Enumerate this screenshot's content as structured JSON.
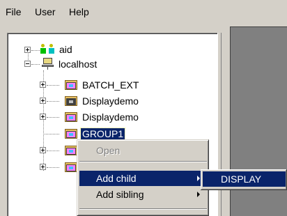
{
  "menubar": {
    "items": [
      "File",
      "User",
      "Help"
    ]
  },
  "tree": {
    "nodes": [
      {
        "label": "aid",
        "icon": "people-icon",
        "expander": "plus"
      },
      {
        "label": "localhost",
        "icon": "computer-icon",
        "expander": "minus"
      },
      {
        "label": "BATCH_EXT",
        "icon": "folder-icon",
        "expander": "plus"
      },
      {
        "label": "Displaydemo",
        "icon": "folder-icon",
        "expander": "plus"
      },
      {
        "label": "Displaydemo",
        "icon": "folder-icon",
        "expander": "plus"
      },
      {
        "label": "GROUP1",
        "icon": "folder-icon",
        "selected": true
      },
      {
        "label": "",
        "icon": "folder-icon",
        "expander": "plus"
      },
      {
        "label": "",
        "icon": "folder-icon",
        "expander": "plus"
      }
    ]
  },
  "context_menu": {
    "items": [
      {
        "label": "Open",
        "state": "disabled"
      },
      {
        "label": "Add child",
        "state": "active",
        "submenu": true
      },
      {
        "label": "Add sibling",
        "state": "normal",
        "submenu": true
      }
    ],
    "submenu": {
      "items": [
        {
          "label": "DISPLAY",
          "state": "active"
        }
      ]
    }
  },
  "colors": {
    "face": "#d4d0c8",
    "highlight": "#0a246a",
    "right_panel": "#808080"
  }
}
